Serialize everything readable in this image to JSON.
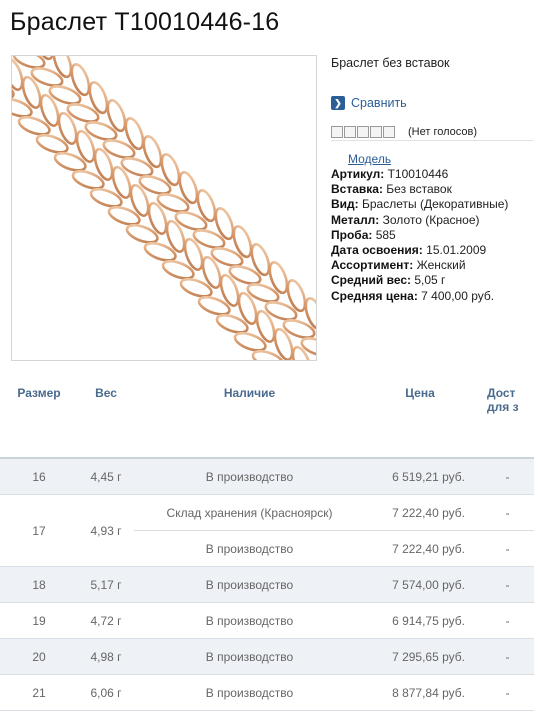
{
  "page": {
    "title": "Браслет Т10010446-16"
  },
  "product": {
    "subtitle": "Браслет без вставок",
    "compare_label": "Сравнить",
    "compare_icon": "chevron-right-icon",
    "votes_label": "(Нет голосов)",
    "rating_stars": 0,
    "rating_max": 5,
    "model_link": "Модель",
    "attributes": [
      {
        "label": "Артикул:",
        "value": " Т10010446"
      },
      {
        "label": "Вставка:",
        "value": " Без вставок"
      },
      {
        "label": "Вид:",
        "value": " Браслеты (Декоративные)"
      },
      {
        "label": "Металл:",
        "value": " Золото (Красное)"
      },
      {
        "label": "Проба:",
        "value": " 585"
      },
      {
        "label": "Дата освоения:",
        "value": " 15.01.2009"
      },
      {
        "label": "Ассортимент:",
        "value": " Женский"
      },
      {
        "label": "Средний вес:",
        "value": " 5,05 г"
      },
      {
        "label": "Средняя цена:",
        "value": " 7 400,00 руб."
      }
    ]
  },
  "table": {
    "headers": {
      "size": "Размер",
      "weight": "Вес",
      "stock": "Наличие",
      "price": "Цена",
      "delivery_1": "Дост",
      "delivery_2": "для з"
    },
    "rows": [
      {
        "size": "16",
        "weight": "4,45 г",
        "stock": "В производство",
        "price": "6 519,21 руб.",
        "delivery": "-"
      },
      {
        "size": "17",
        "weight": "4,93 г",
        "stock_a": "Склад хранения (Красноярск)",
        "price_a": "7 222,40 руб.",
        "delivery_a": "-",
        "stock_b": "В производство",
        "price_b": "7 222,40 руб.",
        "delivery_b": "-"
      },
      {
        "size": "18",
        "weight": "5,17 г",
        "stock": "В производство",
        "price": "7 574,00 руб.",
        "delivery": "-"
      },
      {
        "size": "19",
        "weight": "4,72 г",
        "stock": "В производство",
        "price": "6 914,75 руб.",
        "delivery": "-"
      },
      {
        "size": "20",
        "weight": "4,98 г",
        "stock": "В производство",
        "price": "7 295,65 руб.",
        "delivery": "-"
      },
      {
        "size": "21",
        "weight": "6,06 г",
        "stock": "В производство",
        "price": "8 877,84 руб.",
        "delivery": "-"
      }
    ]
  },
  "colors": {
    "link": "#2b5e96",
    "header_text": "#4a6a8e",
    "row_shade": "#eef1f5",
    "gold": "#d9a57a"
  }
}
